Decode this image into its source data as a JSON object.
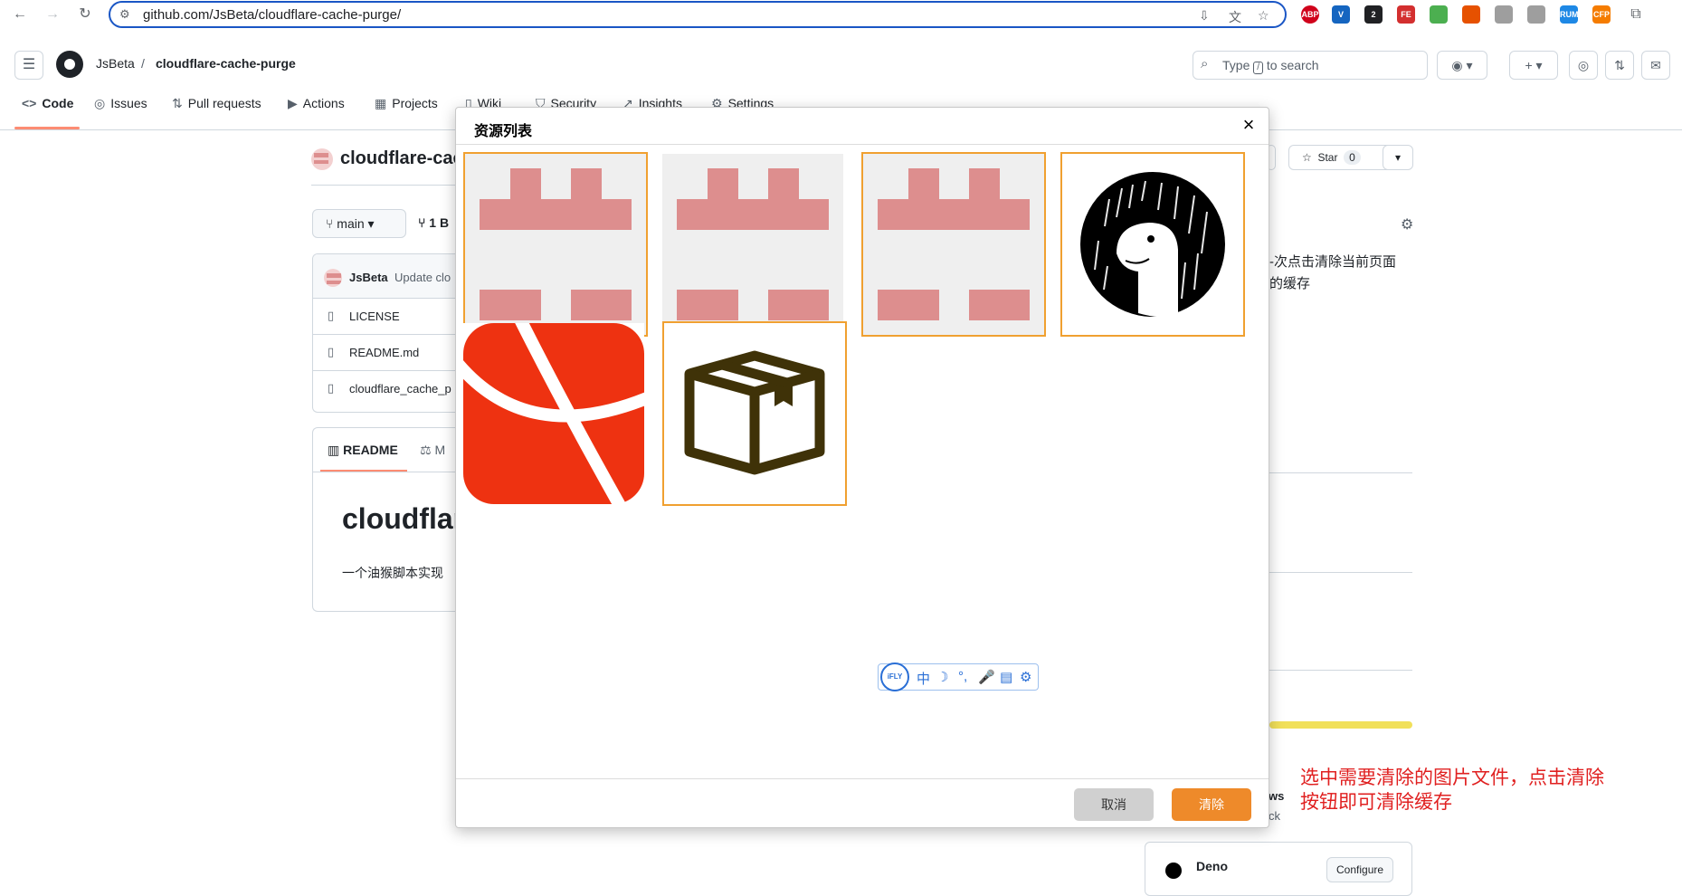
{
  "browser": {
    "url": "github.com/JsBeta/cloudflare-cache-purge/",
    "extensions": [
      {
        "name": "ABP",
        "color": "#d0021b"
      },
      {
        "name": "V",
        "color": "#1565c0"
      },
      {
        "name": "2",
        "color": "#202124"
      },
      {
        "name": "FE",
        "color": "#d32f2f"
      },
      {
        "name": "",
        "color": "#4caf50"
      },
      {
        "name": "",
        "color": "#e65100"
      },
      {
        "name": "",
        "color": "#9e9e9e"
      },
      {
        "name": "",
        "color": "#9e9e9e"
      },
      {
        "name": "RUM",
        "color": "#1e88e5"
      },
      {
        "name": "CFP",
        "color": "#f57c00"
      }
    ]
  },
  "github": {
    "owner": "JsBeta",
    "separator": "/",
    "repo": "cloudflare-cache-purge",
    "search_placeholder_pre": "Type",
    "search_key": "/",
    "search_placeholder_post": "to search",
    "tabs": [
      {
        "label": "Code",
        "icon": "<>"
      },
      {
        "label": "Issues",
        "icon": "◎"
      },
      {
        "label": "Pull requests",
        "icon": "⇅"
      },
      {
        "label": "Actions",
        "icon": "▶"
      },
      {
        "label": "Projects",
        "icon": "▦"
      },
      {
        "label": "Wiki",
        "icon": "▯"
      },
      {
        "label": "Security",
        "icon": "⛉"
      },
      {
        "label": "Insights",
        "icon": "↗"
      },
      {
        "label": "Settings",
        "icon": "⚙"
      }
    ],
    "repo_title": "cloudflare-cac",
    "branch": "main",
    "branches_count": "1 B",
    "star_label": "Star",
    "star_count": "0",
    "commit_author": "JsBeta",
    "commit_message": "Update clo",
    "files": [
      "LICENSE",
      "README.md",
      "cloudflare_cache_p"
    ],
    "readme_tab": "README",
    "readme_tab2": "M",
    "readme_heading": "cloudflar",
    "readme_text": "一个油猴脚本实现",
    "about_text_line1": "-次点击清除当前页面",
    "about_text_line2": "的缓存",
    "deploy_partial1": "ws",
    "deploy_partial2": "ck",
    "deno_label": "Deno",
    "configure_label": "Configure"
  },
  "modal": {
    "title": "资源列表",
    "close": "×",
    "cancel_label": "取消",
    "clear_label": "清除",
    "resources": [
      {
        "icon": "identicon-icon",
        "selected": true
      },
      {
        "icon": "identicon-icon",
        "selected": false
      },
      {
        "icon": "identicon-icon",
        "selected": true
      },
      {
        "icon": "deno-dinosaur-icon",
        "selected": true
      },
      {
        "icon": "red-envelope-icon",
        "selected": false
      },
      {
        "icon": "package-box-icon",
        "selected": true
      }
    ]
  },
  "ifly": {
    "logo": "iFLY",
    "items": [
      "中",
      "☽",
      "°,",
      "🎤",
      "▤",
      "⚙"
    ]
  },
  "annotation": {
    "line1": "选中需要清除的图片文件，点击清除",
    "line2": "按钮即可清除缓存"
  }
}
